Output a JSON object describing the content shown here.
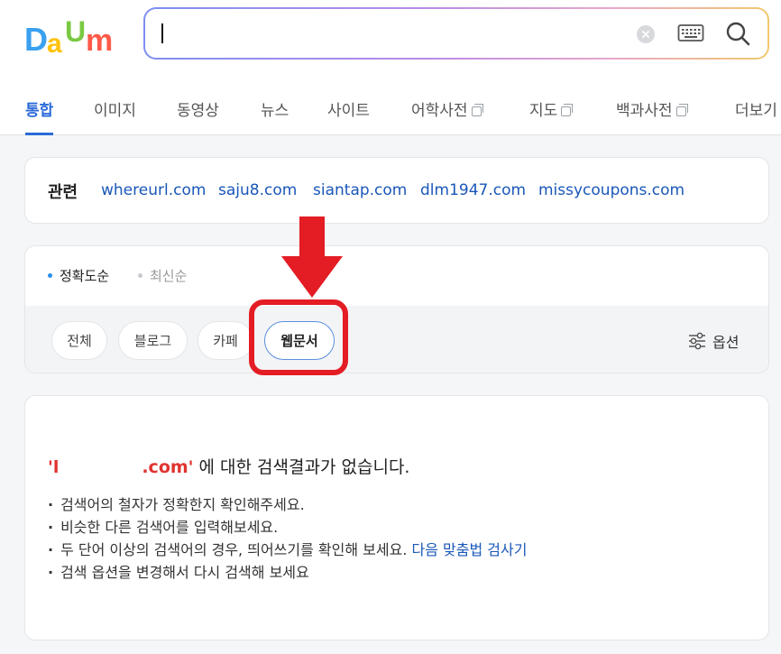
{
  "logo": {
    "letters": [
      "D",
      "a",
      "U",
      "m"
    ],
    "colors": [
      "#3aa0f0",
      "#ffc107",
      "#7ac943",
      "#ff5a49"
    ]
  },
  "search": {
    "value": "",
    "clear_icon": "clear-icon",
    "keyboard_icon": "keyboard-icon",
    "search_icon": "search-icon"
  },
  "tabs": [
    {
      "label": "통합",
      "active": true
    },
    {
      "label": "이미지"
    },
    {
      "label": "동영상"
    },
    {
      "label": "뉴스"
    },
    {
      "label": "사이트"
    },
    {
      "label": "어학사전",
      "popup": true
    },
    {
      "label": "지도",
      "popup": true
    },
    {
      "label": "백과사전",
      "popup": true
    },
    {
      "label": "더보기"
    }
  ],
  "related": {
    "title": "관련",
    "links": [
      "whereurl.com",
      "saju8.com",
      "siantap.com",
      "dlm1947.com",
      "missycoupons.com"
    ]
  },
  "sort": {
    "options": [
      {
        "label": "정확도순",
        "active": true
      },
      {
        "label": "최신순",
        "active": false
      }
    ]
  },
  "chips": [
    {
      "label": "전체"
    },
    {
      "label": "블로그"
    },
    {
      "label": "카페"
    },
    {
      "label": "웹문서",
      "active": true
    }
  ],
  "option_button": {
    "label": "옵션",
    "icon": "sliders-icon"
  },
  "annotation": {
    "color": "#e41c24"
  },
  "result": {
    "query_prefix": "'l",
    "query_suffix": ".com'",
    "message": " 에 대한 검색결과가 없습니다.",
    "tips": [
      {
        "text": "검색어의 철자가 정확한지 확인해주세요."
      },
      {
        "text": "비슷한 다른 검색어를 입력해보세요."
      },
      {
        "text": "두 단어 이상의 검색어의 경우, 띄어쓰기를 확인해 보세요. ",
        "link": "다음 맞춤법 검사기"
      },
      {
        "text": "검색 옵션을 변경해서 다시 검색해 보세요"
      }
    ]
  },
  "colors": {
    "accent": "#2b6ad9",
    "link": "#1a57b8",
    "query": "#e0332f"
  }
}
